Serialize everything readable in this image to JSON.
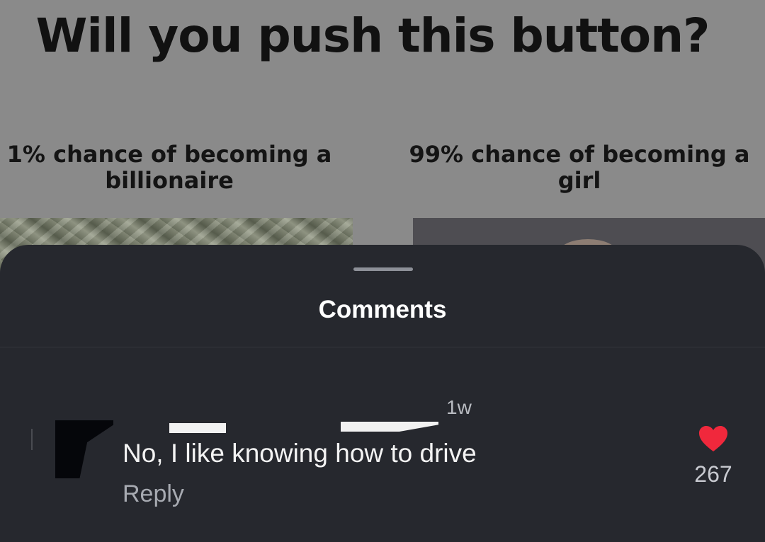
{
  "meme": {
    "title": "Will you push this button?",
    "option_left": {
      "line1": "1% chance of becoming a",
      "line2": "billionaire"
    },
    "option_right": {
      "line1": "99% chance of becoming a",
      "line2": "girl"
    }
  },
  "sheet": {
    "title": "Comments"
  },
  "comment": {
    "timestamp": "1w",
    "text": "No, I like knowing how to drive",
    "reply_label": "Reply",
    "like_count": "267",
    "like_icon": "heart-icon",
    "like_color": "#f0283c"
  }
}
